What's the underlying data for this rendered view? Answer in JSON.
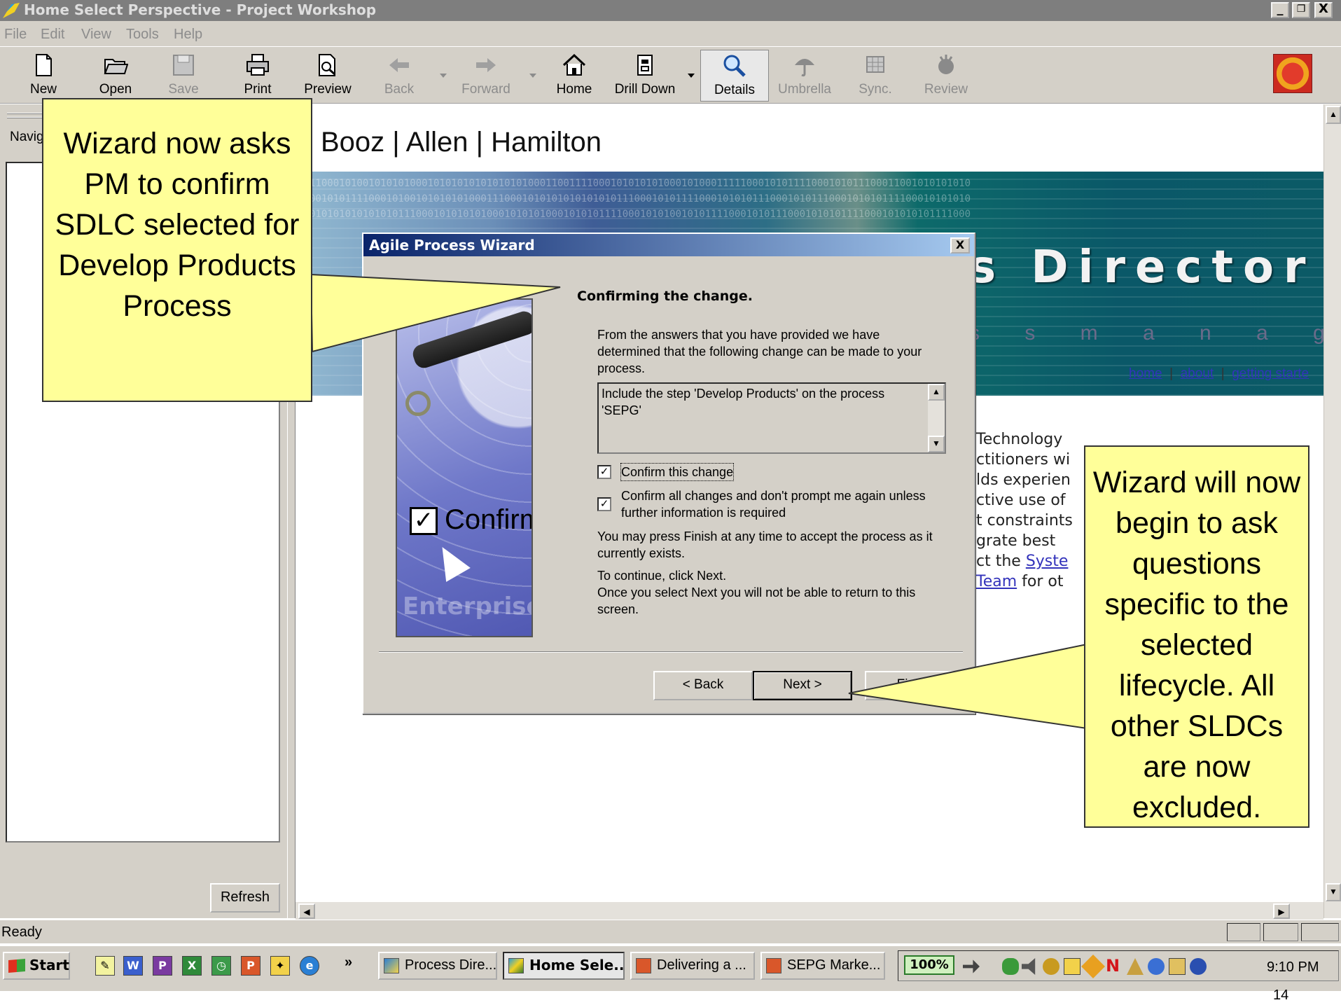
{
  "window": {
    "title": "Home Select Perspective - Project Workshop",
    "controls": [
      "_",
      "❐",
      "X"
    ]
  },
  "menu": [
    "File",
    "Edit",
    "View",
    "Tools",
    "Help"
  ],
  "toolbar": {
    "buttons": [
      {
        "label": "New",
        "icon": "new-document-icon",
        "enabled": true
      },
      {
        "label": "Open",
        "icon": "open-folder-icon",
        "enabled": true
      },
      {
        "label": "Save",
        "icon": "save-disk-icon",
        "enabled": false
      },
      {
        "label": "Print",
        "icon": "printer-icon",
        "enabled": true
      },
      {
        "label": "Preview",
        "icon": "print-preview-icon",
        "enabled": true
      },
      {
        "label": "Back",
        "icon": "back-arrow-icon",
        "enabled": false
      },
      {
        "label": "Forward",
        "icon": "forward-arrow-icon",
        "enabled": false
      },
      {
        "label": "Home",
        "icon": "home-icon",
        "enabled": true
      },
      {
        "label": "Drill Down",
        "icon": "drill-down-icon",
        "enabled": true
      },
      {
        "label": "Details",
        "icon": "magnifier-icon",
        "enabled": true,
        "pressed": true
      },
      {
        "label": "Umbrella",
        "icon": "umbrella-icon",
        "enabled": false
      },
      {
        "label": "Sync.",
        "icon": "sync-icon",
        "enabled": false
      },
      {
        "label": "Review",
        "icon": "review-icon",
        "enabled": false
      }
    ]
  },
  "left_pane": {
    "nav_label": "Navig",
    "refresh_label": "Refresh"
  },
  "content": {
    "company": "Booz | Allen | Hamilton",
    "banner_title": "s Director",
    "banner_subtitle": "s s   m a n a g e m e n t",
    "banner_binary": [
      "1100010100101010100010101010101010101000110011110001010101010001010001111100010101111000101011100011001010101010",
      "0010101111000101001010101010001110001010101010101010111000101011110001010101110001010111000101010111100010101010",
      "0101010101010101110001010101010001010101000101010111100010101001010111100010101110001010101111000101010101111000"
    ],
    "links": {
      "home": "home",
      "separator": "|",
      "about": "about",
      "getting_started": "getting starte"
    },
    "body_lines": [
      "Technology",
      "ctitioners wi",
      "lds experien",
      "ctive use of",
      "t constraints",
      "grate best",
      "ct the ",
      "Team"
    ],
    "body_link_system": "Syste",
    "body_tail": " for ot"
  },
  "dialog": {
    "title": "Agile Process Wizard",
    "close": "X",
    "heading": "Confirming the change.",
    "intro": "From the answers that you have provided we have determined that the following change can be made to your process.",
    "change_text": "Include the step 'Develop Products' on the process 'SEPG'",
    "checkbox_confirm": {
      "label": "Confirm this change",
      "checked": true
    },
    "checkbox_all": {
      "label": "Confirm all changes and don't prompt me again unless further information is required",
      "checked": true
    },
    "finish_note": "You may press Finish at any time to accept the process as it currently exists.",
    "continue_note": "To continue, click Next.",
    "return_note": "Once you select Next you will not be able to return to this screen.",
    "image_text_confirm": "Confirm",
    "image_text_enterprise": "Enterprise",
    "buttons": {
      "back": "< Back",
      "next": "Next >",
      "finish": "Finish"
    }
  },
  "callouts": {
    "left": "Wizard now asks PM to confirm SDLC selected for Develop Products Process",
    "right": "Wizard will now begin to ask questions specific to the selected lifecycle.  All other SLDCs are now excluded."
  },
  "status": {
    "text": "Ready"
  },
  "taskbar": {
    "start": "Start",
    "overflow": "»",
    "quicklaunch_icons": [
      "notepad-icon",
      "word-icon",
      "publisher-icon",
      "excel-icon",
      "project-icon",
      "powerpoint-icon",
      "paint-icon",
      "internet-explorer-icon"
    ],
    "tasks": [
      {
        "label": "Process Dire...",
        "active": false
      },
      {
        "label": "Home Sele...",
        "active": true
      },
      {
        "label": "Delivering a ...",
        "active": false
      },
      {
        "label": "SEPG Marke...",
        "active": false
      }
    ],
    "zoom": "100%",
    "clock": "9:10 PM"
  },
  "page_number": "14"
}
